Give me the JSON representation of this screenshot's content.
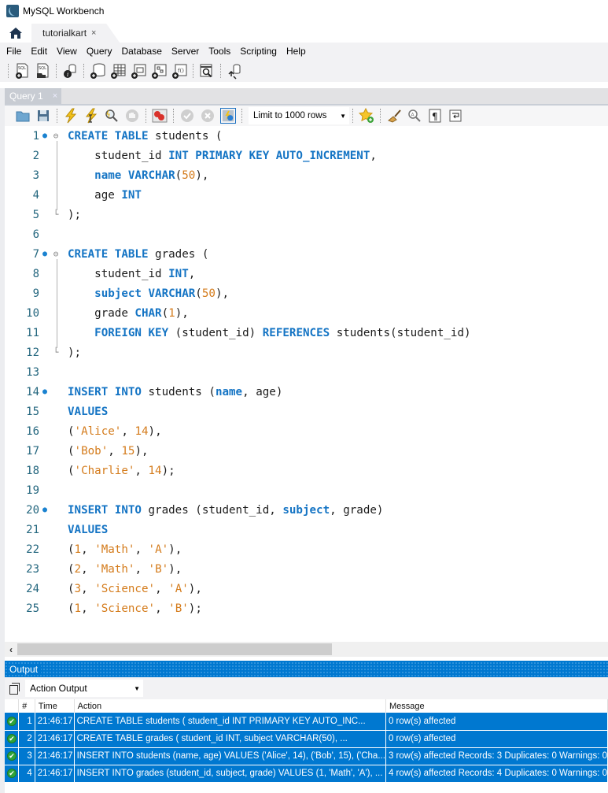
{
  "window": {
    "title": "MySQL Workbench"
  },
  "connection_tabs": [
    {
      "label": "tutorialkart",
      "close": "×"
    }
  ],
  "menu": [
    "File",
    "Edit",
    "View",
    "Query",
    "Database",
    "Server",
    "Tools",
    "Scripting",
    "Help"
  ],
  "main_toolbar": {
    "icons": [
      "new-sql-tab-icon",
      "open-sql-script-icon",
      "schema-inspector-icon",
      "create-schema-icon",
      "create-table-icon",
      "create-view-icon",
      "create-procedure-icon",
      "create-function-icon",
      "search-table-data-icon",
      "reconnect-icon"
    ]
  },
  "query_tab": {
    "label": "Query 1",
    "close": "×"
  },
  "query_toolbar": {
    "limit_select": "Limit to 1000 rows",
    "icons": [
      "open-file-icon",
      "save-icon",
      "execute-icon",
      "execute-current-icon",
      "explain-icon",
      "stop-icon",
      "toggle-error-icon",
      "commit-icon",
      "rollback-icon",
      "autocommit-icon",
      "add-snippet-icon",
      "beautify-icon",
      "find-icon",
      "invisible-chars-icon",
      "word-wrap-icon"
    ]
  },
  "editor": {
    "lines": [
      {
        "n": "1",
        "marker": true,
        "fold": "open",
        "tokens": [
          [
            "kw",
            "CREATE TABLE"
          ],
          [
            "t",
            " students ("
          ]
        ]
      },
      {
        "n": "2",
        "tokens": [
          [
            "t",
            "    student_id "
          ],
          [
            "kw",
            "INT PRIMARY KEY AUTO_INCREMENT"
          ],
          [
            "t",
            ","
          ]
        ]
      },
      {
        "n": "3",
        "tokens": [
          [
            "t",
            "    "
          ],
          [
            "kw",
            "name VARCHAR"
          ],
          [
            "t",
            "("
          ],
          [
            "num",
            "50"
          ],
          [
            "t",
            "),"
          ]
        ]
      },
      {
        "n": "4",
        "tokens": [
          [
            "t",
            "    age "
          ],
          [
            "kw",
            "INT"
          ]
        ]
      },
      {
        "n": "5",
        "fold": "end",
        "tokens": [
          [
            "t",
            ");"
          ]
        ]
      },
      {
        "n": "6",
        "tokens": []
      },
      {
        "n": "7",
        "marker": true,
        "fold": "open",
        "tokens": [
          [
            "kw",
            "CREATE TABLE"
          ],
          [
            "t",
            " grades ("
          ]
        ]
      },
      {
        "n": "8",
        "tokens": [
          [
            "t",
            "    student_id "
          ],
          [
            "kw",
            "INT"
          ],
          [
            "t",
            ","
          ]
        ]
      },
      {
        "n": "9",
        "tokens": [
          [
            "t",
            "    "
          ],
          [
            "kw",
            "subject VARCHAR"
          ],
          [
            "t",
            "("
          ],
          [
            "num",
            "50"
          ],
          [
            "t",
            "),"
          ]
        ]
      },
      {
        "n": "10",
        "tokens": [
          [
            "t",
            "    grade "
          ],
          [
            "kw",
            "CHAR"
          ],
          [
            "t",
            "("
          ],
          [
            "num",
            "1"
          ],
          [
            "t",
            "),"
          ]
        ]
      },
      {
        "n": "11",
        "tokens": [
          [
            "t",
            "    "
          ],
          [
            "kw",
            "FOREIGN KEY"
          ],
          [
            "t",
            " (student_id) "
          ],
          [
            "kw",
            "REFERENCES"
          ],
          [
            "t",
            " students(student_id)"
          ]
        ]
      },
      {
        "n": "12",
        "fold": "end",
        "tokens": [
          [
            "t",
            ");"
          ]
        ]
      },
      {
        "n": "13",
        "tokens": []
      },
      {
        "n": "14",
        "marker": true,
        "tokens": [
          [
            "kw",
            "INSERT INTO"
          ],
          [
            "t",
            " students ("
          ],
          [
            "kw",
            "name"
          ],
          [
            "t",
            ", age)"
          ]
        ]
      },
      {
        "n": "15",
        "tokens": [
          [
            "kw",
            "VALUES"
          ]
        ]
      },
      {
        "n": "16",
        "tokens": [
          [
            "t",
            "("
          ],
          [
            "str",
            "'Alice'"
          ],
          [
            "t",
            ", "
          ],
          [
            "num",
            "14"
          ],
          [
            "t",
            "),"
          ]
        ]
      },
      {
        "n": "17",
        "tokens": [
          [
            "t",
            "("
          ],
          [
            "str",
            "'Bob'"
          ],
          [
            "t",
            ", "
          ],
          [
            "num",
            "15"
          ],
          [
            "t",
            "),"
          ]
        ]
      },
      {
        "n": "18",
        "tokens": [
          [
            "t",
            "("
          ],
          [
            "str",
            "'Charlie'"
          ],
          [
            "t",
            ", "
          ],
          [
            "num",
            "14"
          ],
          [
            "t",
            ");"
          ]
        ]
      },
      {
        "n": "19",
        "tokens": []
      },
      {
        "n": "20",
        "marker": true,
        "tokens": [
          [
            "kw",
            "INSERT INTO"
          ],
          [
            "t",
            " grades (student_id, "
          ],
          [
            "kw",
            "subject"
          ],
          [
            "t",
            ", grade)"
          ]
        ]
      },
      {
        "n": "21",
        "tokens": [
          [
            "kw",
            "VALUES"
          ]
        ]
      },
      {
        "n": "22",
        "tokens": [
          [
            "t",
            "("
          ],
          [
            "num",
            "1"
          ],
          [
            "t",
            ", "
          ],
          [
            "str",
            "'Math'"
          ],
          [
            "t",
            ", "
          ],
          [
            "str",
            "'A'"
          ],
          [
            "t",
            "),"
          ]
        ]
      },
      {
        "n": "23",
        "tokens": [
          [
            "t",
            "("
          ],
          [
            "num",
            "2"
          ],
          [
            "t",
            ", "
          ],
          [
            "str",
            "'Math'"
          ],
          [
            "t",
            ", "
          ],
          [
            "str",
            "'B'"
          ],
          [
            "t",
            "),"
          ]
        ]
      },
      {
        "n": "24",
        "tokens": [
          [
            "t",
            "("
          ],
          [
            "num",
            "3"
          ],
          [
            "t",
            ", "
          ],
          [
            "str",
            "'Science'"
          ],
          [
            "t",
            ", "
          ],
          [
            "str",
            "'A'"
          ],
          [
            "t",
            "),"
          ]
        ]
      },
      {
        "n": "25",
        "tokens": [
          [
            "t",
            "("
          ],
          [
            "num",
            "1"
          ],
          [
            "t",
            ", "
          ],
          [
            "str",
            "'Science'"
          ],
          [
            "t",
            ", "
          ],
          [
            "str",
            "'B'"
          ],
          [
            "t",
            ");"
          ]
        ]
      }
    ]
  },
  "output": {
    "title": "Output",
    "view_select": "Action Output",
    "columns": [
      "",
      "#",
      "Time",
      "Action",
      "Message"
    ],
    "rows": [
      {
        "status": "success",
        "num": "1",
        "time": "21:46:17",
        "action": "CREATE TABLE students (     student_id INT PRIMARY KEY AUTO_INC...",
        "message": "0 row(s) affected"
      },
      {
        "status": "success",
        "num": "2",
        "time": "21:46:17",
        "action": "CREATE TABLE grades (     student_id INT,     subject VARCHAR(50),     ...",
        "message": "0 row(s) affected"
      },
      {
        "status": "success",
        "num": "3",
        "time": "21:46:17",
        "action": "INSERT INTO students (name, age) VALUES ('Alice', 14), ('Bob', 15), ('Cha...",
        "message": "3 row(s) affected Records: 3  Duplicates: 0  Warnings: 0"
      },
      {
        "status": "success",
        "num": "4",
        "time": "21:46:17",
        "action": "INSERT INTO grades (student_id, subject, grade) VALUES (1, 'Math', 'A'), ...",
        "message": "4 row(s) affected Records: 4  Duplicates: 0  Warnings: 0"
      }
    ]
  },
  "colors": {
    "accent": "#0078d0",
    "keyword": "#1474c4",
    "literal": "#d47b1b",
    "success": "#2fa43b"
  }
}
